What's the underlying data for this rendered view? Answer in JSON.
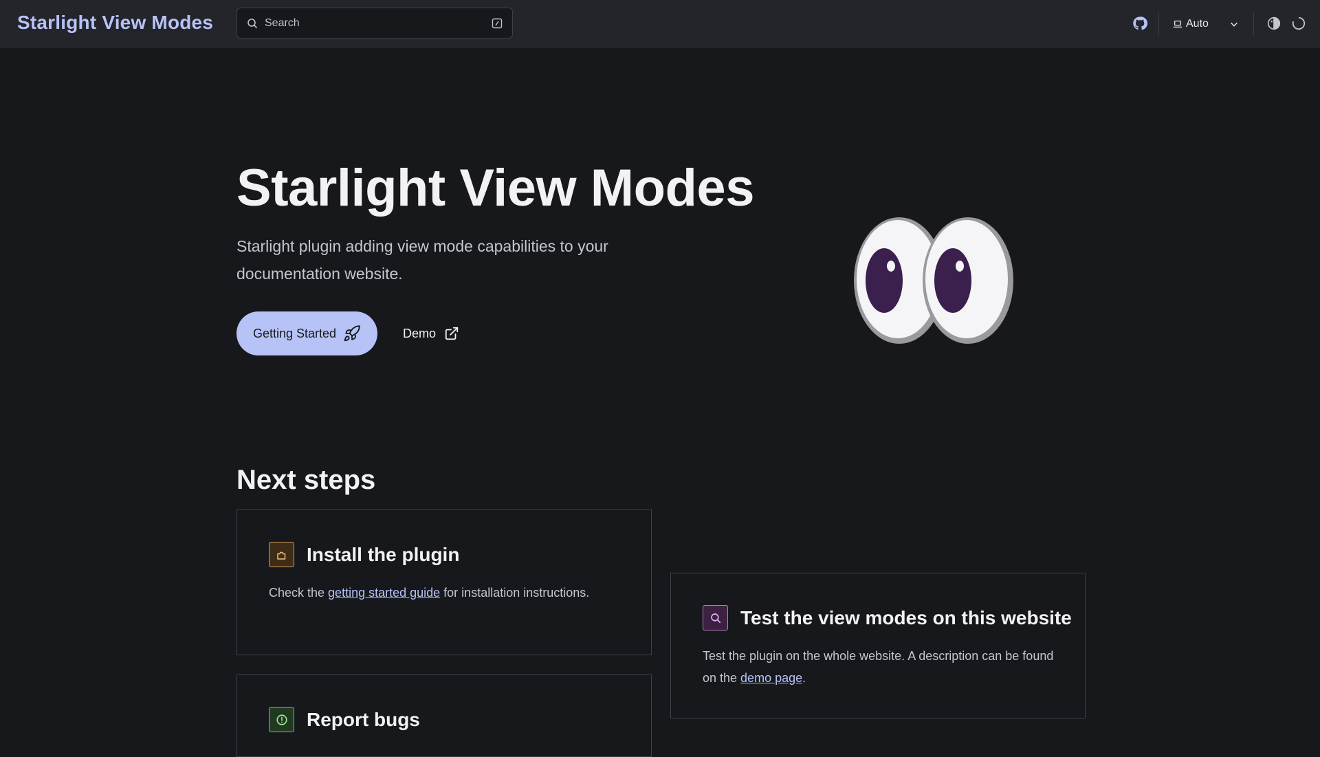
{
  "header": {
    "site_title": "Starlight View Modes",
    "search": {
      "label": "Search"
    },
    "theme_select": {
      "value": "Auto"
    }
  },
  "hero": {
    "title": "Starlight View Modes",
    "tagline": "Starlight plugin adding view mode capabilities to your documentation website.",
    "primary_button": "Getting Started",
    "secondary_button": "Demo"
  },
  "next_steps": {
    "heading": "Next steps",
    "cards": [
      {
        "title": "Install the plugin",
        "text_before": "Check the ",
        "link": "getting started guide",
        "text_after": " for installation instructions."
      },
      {
        "title": "Test the view modes on this website",
        "text_before": "Test the plugin on the whole website. A description can be found on the ",
        "link": "demo page",
        "text_after": "."
      },
      {
        "title": "Report bugs"
      }
    ]
  },
  "colors": {
    "accent": "#b7c3f7",
    "background": "#17181c",
    "header_bg": "#23252b",
    "eye_pupil": "#3b1f4d"
  }
}
